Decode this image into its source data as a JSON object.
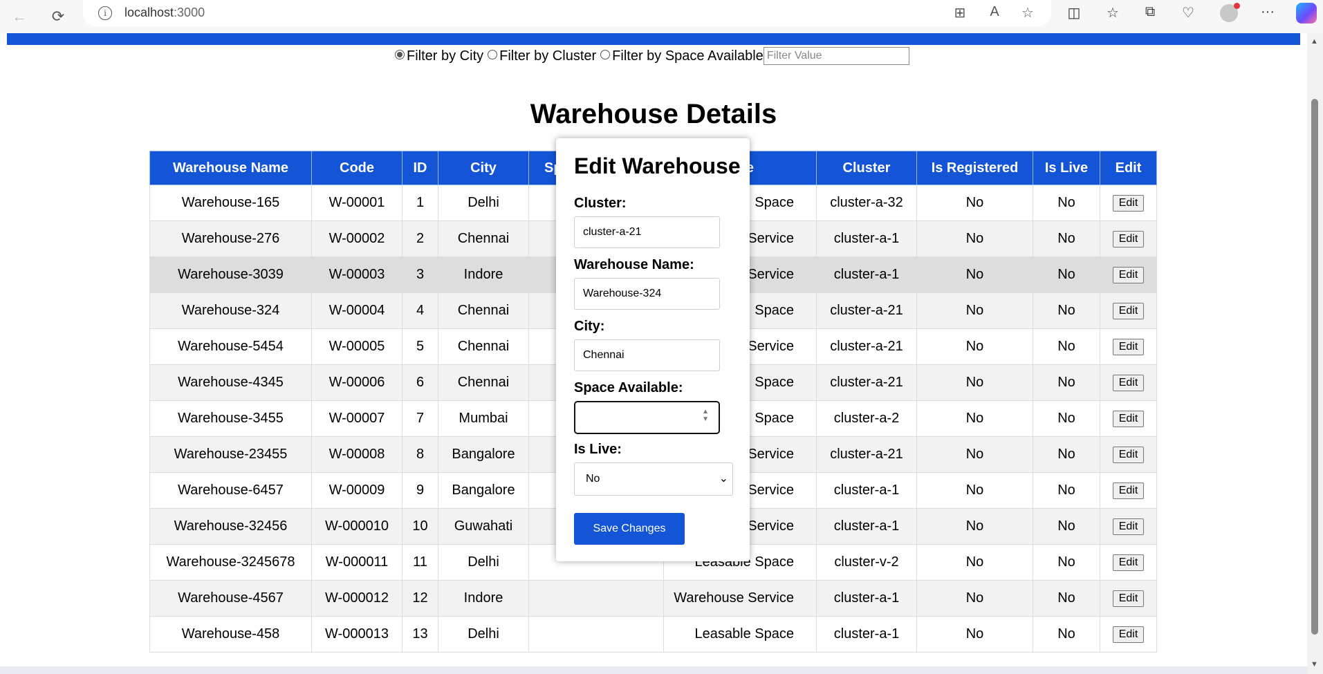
{
  "browser": {
    "url_host": "localhost",
    "url_port": ":3000",
    "back_icon": "←",
    "refresh_icon": "⟳",
    "more_icon": "···"
  },
  "filters": {
    "options": [
      "Filter by City",
      "Filter by Cluster",
      "Filter by Space Available"
    ],
    "selected_index": 0,
    "placeholder": "Filter Value"
  },
  "title": "Warehouse Details",
  "table": {
    "columns": [
      "Warehouse Name",
      "Code",
      "ID",
      "City",
      "Sp",
      "e",
      "Cluster",
      "Is Registered",
      "Is Live",
      "Edit"
    ],
    "edit_label": "Edit",
    "rows": [
      {
        "name": "Warehouse-165",
        "code": "W-00001",
        "id": "1",
        "city": "Delhi",
        "space": "",
        "type": "Space",
        "cluster": "cluster-a-32",
        "registered": "No",
        "live": "No"
      },
      {
        "name": "Warehouse-276",
        "code": "W-00002",
        "id": "2",
        "city": "Chennai",
        "space": "",
        "type": "Service",
        "cluster": "cluster-a-1",
        "registered": "No",
        "live": "No"
      },
      {
        "name": "Warehouse-3039",
        "code": "W-00003",
        "id": "3",
        "city": "Indore",
        "space": "",
        "type": "Service",
        "cluster": "cluster-a-1",
        "registered": "No",
        "live": "No"
      },
      {
        "name": "Warehouse-324",
        "code": "W-00004",
        "id": "4",
        "city": "Chennai",
        "space": "",
        "type": "Space",
        "cluster": "cluster-a-21",
        "registered": "No",
        "live": "No"
      },
      {
        "name": "Warehouse-5454",
        "code": "W-00005",
        "id": "5",
        "city": "Chennai",
        "space": "",
        "type": "Service",
        "cluster": "cluster-a-21",
        "registered": "No",
        "live": "No"
      },
      {
        "name": "Warehouse-4345",
        "code": "W-00006",
        "id": "6",
        "city": "Chennai",
        "space": "",
        "type": "Space",
        "cluster": "cluster-a-21",
        "registered": "No",
        "live": "No"
      },
      {
        "name": "Warehouse-3455",
        "code": "W-00007",
        "id": "7",
        "city": "Mumbai",
        "space": "",
        "type": "Space",
        "cluster": "cluster-a-2",
        "registered": "No",
        "live": "No"
      },
      {
        "name": "Warehouse-23455",
        "code": "W-00008",
        "id": "8",
        "city": "Bangalore",
        "space": "",
        "type": "Service",
        "cluster": "cluster-a-21",
        "registered": "No",
        "live": "No"
      },
      {
        "name": "Warehouse-6457",
        "code": "W-00009",
        "id": "9",
        "city": "Bangalore",
        "space": "",
        "type": "Service",
        "cluster": "cluster-a-1",
        "registered": "No",
        "live": "No"
      },
      {
        "name": "Warehouse-32456",
        "code": "W-000010",
        "id": "10",
        "city": "Guwahati",
        "space": "",
        "type": "Service",
        "cluster": "cluster-a-1",
        "registered": "No",
        "live": "No"
      },
      {
        "name": "Warehouse-3245678",
        "code": "W-000011",
        "id": "11",
        "city": "Delhi",
        "space": "",
        "type": "Leasable Space",
        "cluster": "cluster-v-2",
        "registered": "No",
        "live": "No"
      },
      {
        "name": "Warehouse-4567",
        "code": "W-000012",
        "id": "12",
        "city": "Indore",
        "space": "",
        "type": "Warehouse Service",
        "cluster": "cluster-a-1",
        "registered": "No",
        "live": "No"
      },
      {
        "name": "Warehouse-458",
        "code": "W-000013",
        "id": "13",
        "city": "Delhi",
        "space": "",
        "type": "Leasable Space",
        "cluster": "cluster-a-1",
        "registered": "No",
        "live": "No"
      }
    ]
  },
  "modal": {
    "title": "Edit Warehouse",
    "cluster_label": "Cluster:",
    "cluster_value": "cluster-a-21",
    "name_label": "Warehouse Name:",
    "name_value": "Warehouse-324",
    "city_label": "City:",
    "city_value": "Chennai",
    "space_label": "Space Available:",
    "space_value": "",
    "live_label": "Is Live:",
    "live_value": "No",
    "save_label": "Save Changes"
  },
  "colors": {
    "accent": "#1454d6",
    "row_alt": "#f2f2f2",
    "row_hover": "#dddddd"
  }
}
